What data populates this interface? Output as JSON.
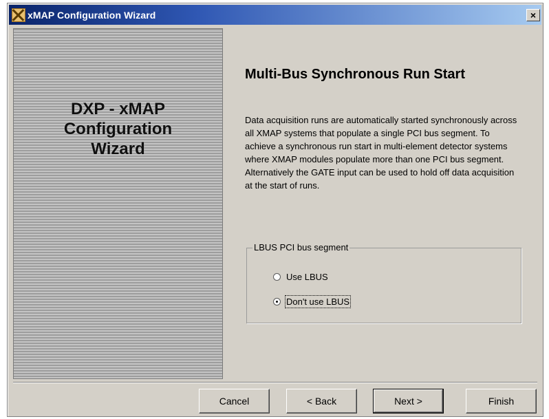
{
  "window": {
    "title": "xMAP Configuration Wizard",
    "close_label": "×"
  },
  "side_panel": {
    "title": "DXP - xMAP\nConfiguration\nWizard"
  },
  "page": {
    "heading": "Multi-Bus Synchronous Run Start",
    "description": "Data acquisition runs are automatically started synchronously across all XMAP systems that populate a single PCI bus segment. To achieve a synchronous run start in multi-element detector systems where XMAP modules populate more than one PCI bus segment. Alternatively the GATE input can be used to hold off data acquisition at the start of runs."
  },
  "lbus_group": {
    "legend": "LBUS PCI bus segment",
    "options": [
      {
        "label": "Use LBUS",
        "selected": false
      },
      {
        "label": "Don't use LBUS",
        "selected": true
      }
    ]
  },
  "buttons": {
    "cancel": "Cancel",
    "back": "< Back",
    "next": "Next >",
    "finish": "Finish"
  }
}
